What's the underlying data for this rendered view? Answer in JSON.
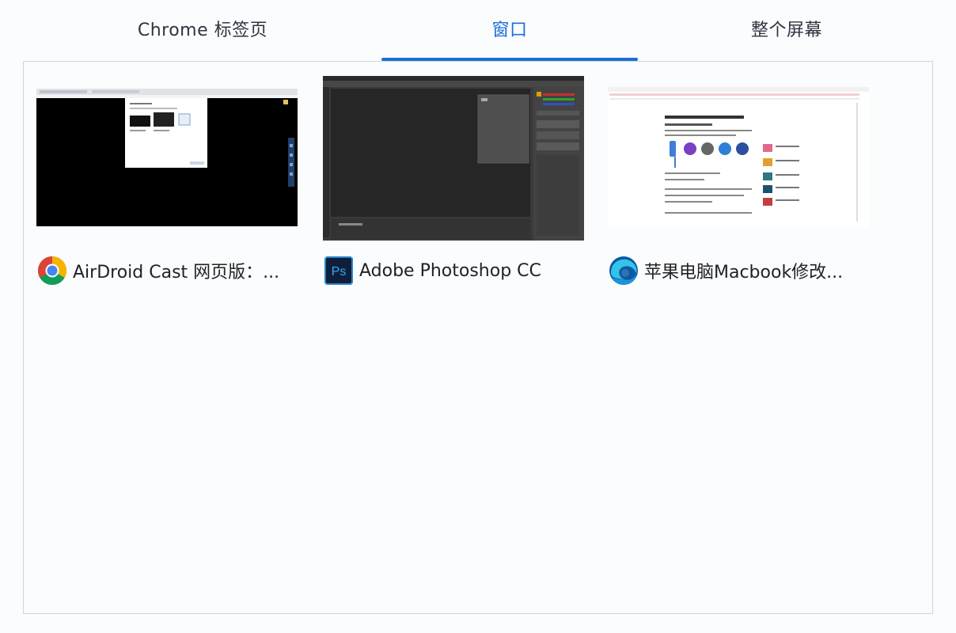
{
  "tabs": [
    {
      "label": "Chrome 标签页",
      "active": false
    },
    {
      "label": "窗口",
      "active": true
    },
    {
      "label": "整个屏幕",
      "active": false
    }
  ],
  "accent_color": "#1a6fd8",
  "windows": [
    {
      "title": "AirDroid Cast 网页版：...",
      "icon": "chrome-icon",
      "thumbnail": "black-screen-with-dialog"
    },
    {
      "title": "Adobe Photoshop CC",
      "icon": "photoshop-icon",
      "thumbnail": "photoshop-dark-workspace"
    },
    {
      "title": "苹果电脑Macbook修改...",
      "icon": "edge-icon",
      "thumbnail": "white-webpage"
    }
  ],
  "photoshop_icon_text": "Ps"
}
